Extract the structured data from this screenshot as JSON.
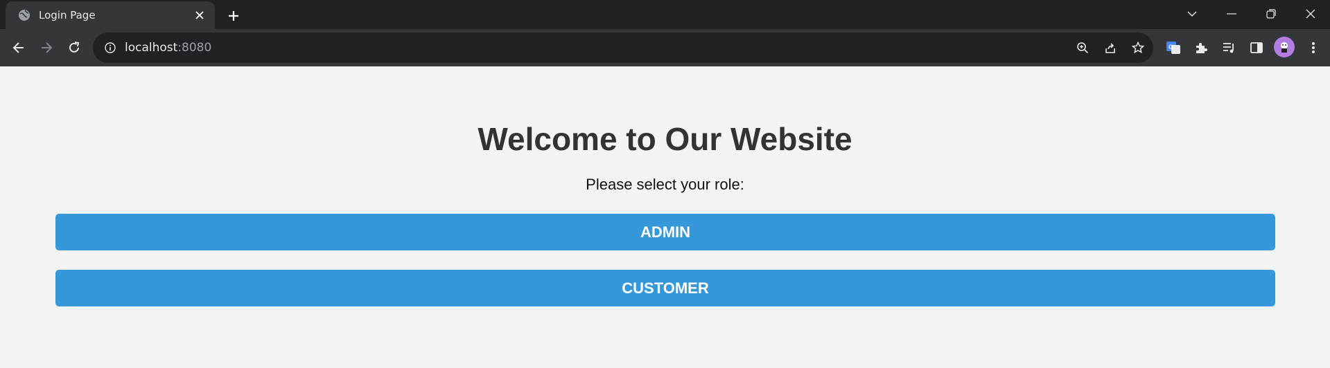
{
  "browser": {
    "tab_title": "Login Page",
    "url_host": "localhost",
    "url_port": ":8080"
  },
  "page": {
    "heading": "Welcome to Our Website",
    "subtitle": "Please select your role:",
    "buttons": [
      {
        "label": "ADMIN"
      },
      {
        "label": "CUSTOMER"
      }
    ]
  },
  "colors": {
    "button_bg": "#3498db",
    "page_bg": "#f4f4f4",
    "heading": "#333333"
  },
  "icons": [
    "globe-icon",
    "close-icon",
    "plus-icon",
    "chevron-down-icon",
    "minimize-icon",
    "restore-icon",
    "window-close-icon",
    "back-icon",
    "forward-icon",
    "reload-icon",
    "info-icon",
    "zoom-icon",
    "share-icon",
    "star-icon",
    "translate-icon",
    "extensions-icon",
    "reading-list-icon",
    "side-panel-icon",
    "profile-avatar",
    "kebab-menu-icon"
  ]
}
